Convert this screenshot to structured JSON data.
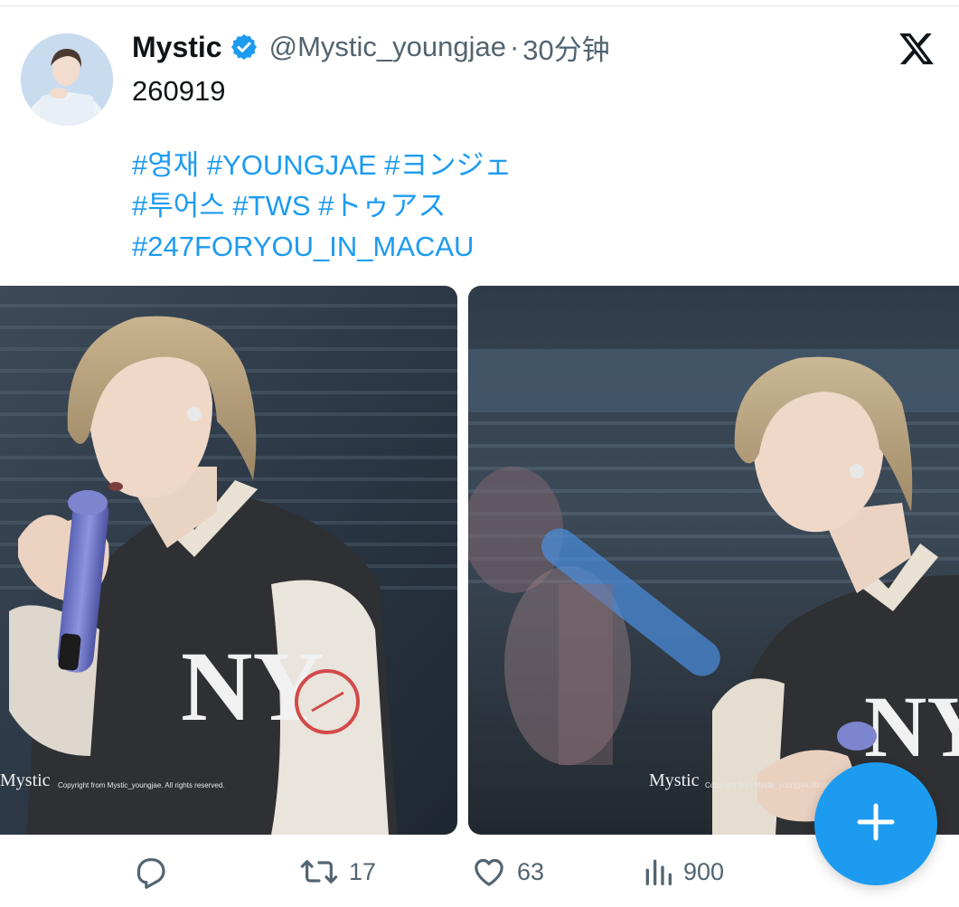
{
  "author": {
    "display_name": "Mystic",
    "verified": true,
    "handle": "@Mystic_youngjae",
    "separator": "·",
    "time": "30分钟"
  },
  "tweet": {
    "text": "260919",
    "hashtag_lines": [
      "#영재 #YOUNGJAE #ヨンジェ",
      "#투어스 #TWS #トゥアス",
      "#247FORYOU_IN_MACAU"
    ]
  },
  "media": {
    "watermark_name": "Mystic",
    "watermark_copyright": "Copyright from Mystic_youngjae. All rights reserved."
  },
  "actions": {
    "reply_count": "",
    "retweet_count": "17",
    "like_count": "63",
    "views_count": "900"
  },
  "icons": {
    "platform": "x-logo-icon",
    "verified": "verified-badge-icon",
    "reply": "reply-icon",
    "retweet": "retweet-icon",
    "like": "heart-icon",
    "views": "views-icon",
    "compose": "plus-icon"
  },
  "colors": {
    "accent": "#1d9bf0",
    "muted_text": "#536471",
    "text": "#0f1419"
  }
}
